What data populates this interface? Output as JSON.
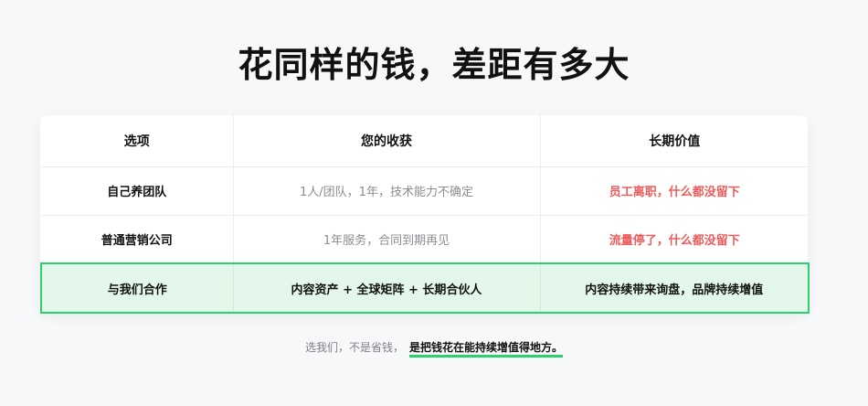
{
  "title": "花同样的钱，差距有多大",
  "table": {
    "headers": [
      "选项",
      "您的收获",
      "长期价值"
    ],
    "rows": [
      {
        "option": "自己养团队",
        "gain": "1人/团队，1年，技术能力不确定",
        "value": "员工离职，什么都没留下"
      },
      {
        "option": "普通营销公司",
        "gain": "1年服务，合同到期再见",
        "value": "流量停了，什么都没留下"
      },
      {
        "option": "与我们合作",
        "gain": "内容资产 + 全球矩阵 + 长期合伙人",
        "value": "内容持续带来询盘，品牌持续增值"
      }
    ]
  },
  "footer": {
    "lead": "选我们，不是省钱，",
    "emphasis": "是把钱花在能持续增值得地方。"
  },
  "colors": {
    "accent_green": "#2bd16a",
    "highlight_bg": "#e3f8ea",
    "warning_red": "#ef5a5a"
  }
}
